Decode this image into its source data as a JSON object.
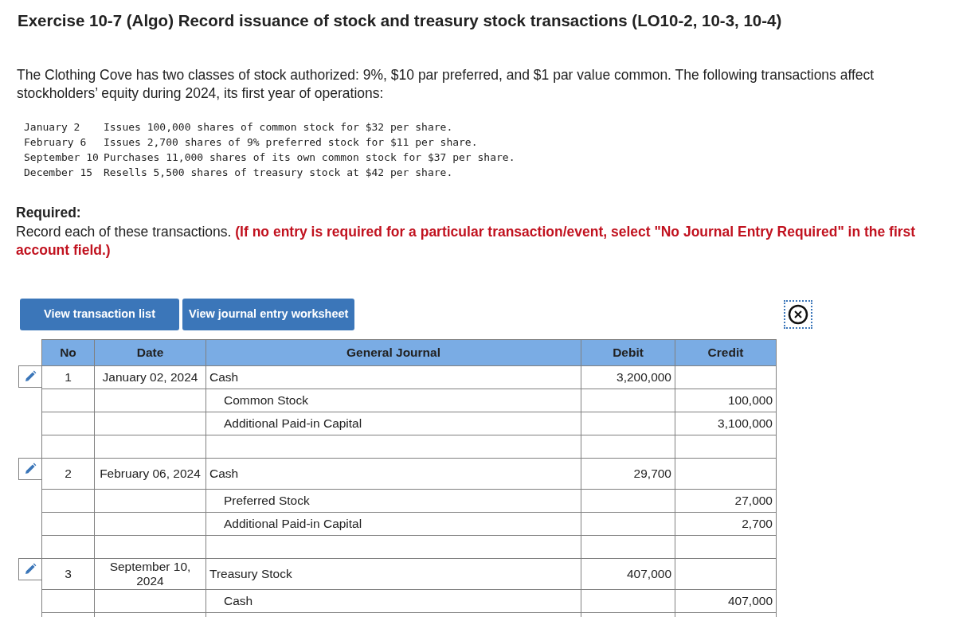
{
  "title": "Exercise 10-7 (Algo) Record issuance of stock and treasury stock transactions (LO10-2, 10-3, 10-4)",
  "intro": "The Clothing Cove has two classes of stock authorized: 9%, $10 par preferred, and $1 par value common. The following transactions affect stockholders’ equity during 2024, its first year of operations:",
  "transactions": [
    {
      "date": "January 2",
      "text": "Issues 100,000 shares of common stock for $32 per share."
    },
    {
      "date": "February 6",
      "text": "Issues 2,700 shares of 9% preferred stock for $11 per share."
    },
    {
      "date": "September 10",
      "text": "Purchases 11,000 shares of its own common stock for $37 per share."
    },
    {
      "date": "December 15",
      "text": "Resells 5,500 shares of treasury stock at $42 per share."
    }
  ],
  "required_heading": "Required:",
  "required_text": "Record each of these transactions. **(If no entry is required for a particular transaction/event, select \"No Journal Entry Required\" in the first account field.)**",
  "buttons": [
    "View transaction list",
    "View journal entry worksheet"
  ],
  "journal": {
    "columns": [
      "No",
      "Date",
      "General Journal",
      "Debit",
      "Credit"
    ],
    "entries": [
      {
        "no": "1",
        "date": "January 02, 2024",
        "lines": [
          {
            "kind": "debit",
            "account": "Cash",
            "debit": "3,200,000"
          },
          {
            "kind": "credit",
            "account": "Common Stock",
            "credit": "100,000"
          },
          {
            "kind": "credit",
            "account": "Additional Paid-in Capital",
            "credit": "3,100,000"
          }
        ]
      },
      {
        "no": "2",
        "date": "February 06, 2024",
        "lines": [
          {
            "kind": "debit",
            "account": "Cash",
            "debit": "29,700"
          },
          {
            "kind": "credit",
            "account": "Preferred Stock",
            "credit": "27,000"
          },
          {
            "kind": "credit",
            "account": "Additional Paid-in Capital",
            "credit": "2,700"
          }
        ]
      },
      {
        "no": "3",
        "date": "September 10, 2024",
        "lines": [
          {
            "kind": "debit",
            "account": "Treasury Stock",
            "debit": "407,000"
          },
          {
            "kind": "credit",
            "account": "Cash",
            "credit": "407,000"
          }
        ]
      }
    ]
  }
}
